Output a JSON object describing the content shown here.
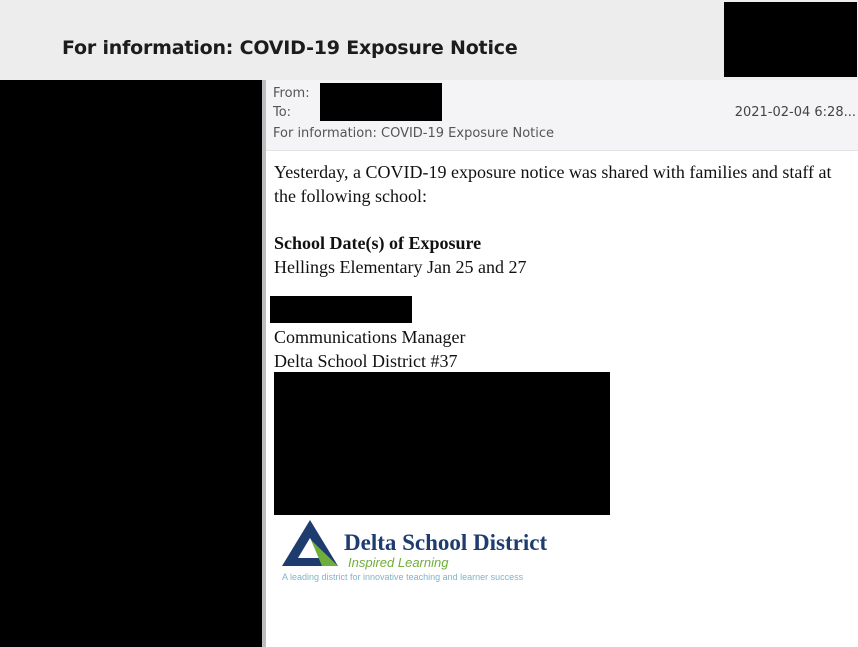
{
  "window": {
    "title": "For information: COVID-19 Exposure Notice"
  },
  "email": {
    "from_label": "From:",
    "to_label": "To:",
    "subject": "For information: COVID-19 Exposure Notice",
    "date": "2021-02-04  6:28..."
  },
  "body": {
    "line1": "Yesterday, a COVID-19 exposure notice was shared with families and staff at",
    "line2": "the following school:",
    "heading": "School Date(s) of Exposure",
    "exposure": "Hellings Elementary Jan 25 and 27",
    "signature_title": "Communications Manager",
    "signature_org": "Delta School District #37"
  },
  "logo": {
    "name": "Delta School District",
    "tagline": "Inspired Learning",
    "subtitle": "A leading district for innovative teaching and learner success",
    "colors": {
      "navy": "#1f3c6e",
      "green": "#6fae3b",
      "teal": "#7fb4c9"
    }
  }
}
